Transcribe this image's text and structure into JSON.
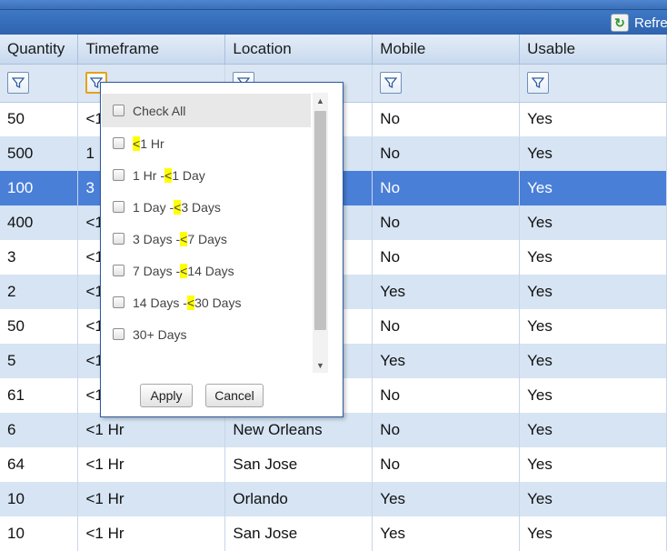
{
  "toolbar": {
    "refresh_label": "Refres"
  },
  "columns": [
    "Quantity",
    "Timeframe",
    "Location",
    "Mobile",
    "Usable"
  ],
  "rows": [
    [
      "50",
      "<1",
      "",
      "No",
      "Yes"
    ],
    [
      "500",
      "1",
      "",
      "No",
      "Yes"
    ],
    [
      "100",
      "3",
      "",
      "No",
      "Yes"
    ],
    [
      "400",
      "<1",
      "",
      "No",
      "Yes"
    ],
    [
      "3",
      "<1",
      "",
      "No",
      "Yes"
    ],
    [
      "2",
      "<1",
      "",
      "Yes",
      "Yes"
    ],
    [
      "50",
      "<1",
      "",
      "No",
      "Yes"
    ],
    [
      "5",
      "<1",
      "",
      "Yes",
      "Yes"
    ],
    [
      "61",
      "<1",
      "",
      "No",
      "Yes"
    ],
    [
      "6",
      "<1 Hr",
      "New Orleans",
      "No",
      "Yes"
    ],
    [
      "64",
      "<1 Hr",
      "San Jose",
      "No",
      "Yes"
    ],
    [
      "10",
      "<1 Hr",
      "Orlando",
      "Yes",
      "Yes"
    ],
    [
      "10",
      "<1 Hr",
      "San Jose",
      "Yes",
      "Yes"
    ]
  ],
  "filter_popup": {
    "check_all_label": "Check All",
    "options": [
      {
        "pre": "",
        "lt": "<",
        "post": "1 Hr"
      },
      {
        "pre": "1 Hr - ",
        "lt": "<",
        "post": "1 Day"
      },
      {
        "pre": "1 Day - ",
        "lt": "<",
        "post": "3 Days"
      },
      {
        "pre": "3 Days - ",
        "lt": "<",
        "post": "7 Days"
      },
      {
        "pre": "7 Days - ",
        "lt": "<",
        "post": "14 Days"
      },
      {
        "pre": "14 Days - ",
        "lt": "<",
        "post": "30 Days"
      },
      {
        "pre": "30+ Days",
        "lt": "",
        "post": ""
      }
    ],
    "apply_label": "Apply",
    "cancel_label": "Cancel"
  },
  "colors": {
    "header_blue": "#3a6fb8",
    "selected_row": "#4a7fd8",
    "alt_row": "#d6e4f3",
    "highlight": "#ffff00"
  },
  "icons": {
    "refresh": "refresh-icon",
    "filter": "filter-icon"
  }
}
